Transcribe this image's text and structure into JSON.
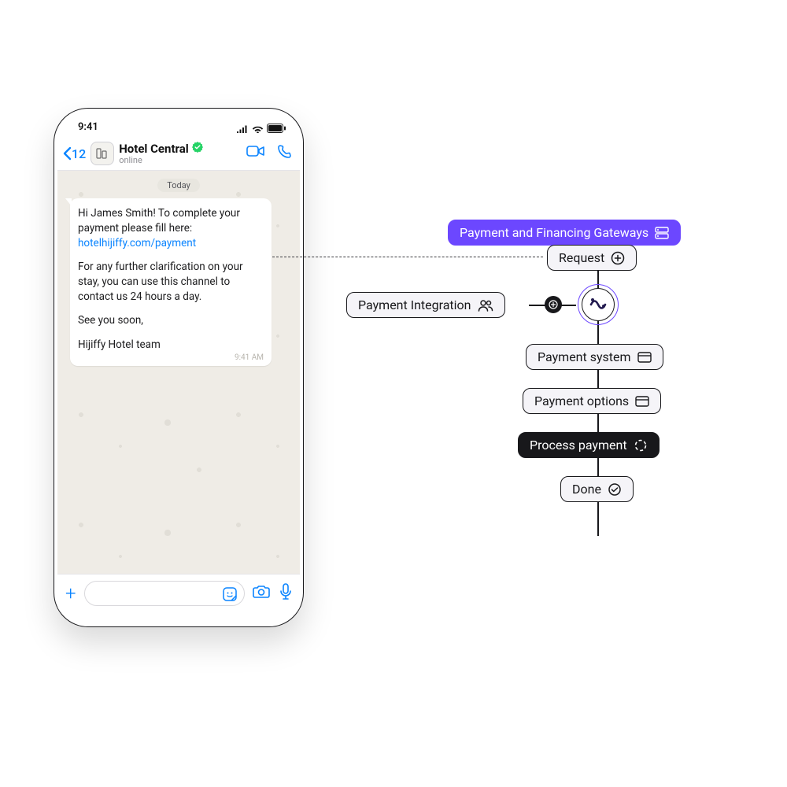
{
  "phone": {
    "status_time": "9:41",
    "back_count": "12",
    "contact": {
      "name": "Hotel Central",
      "status": "online"
    },
    "day_label": "Today",
    "message": {
      "greeting": "Hi James Smith! To complete your payment please fill here:",
      "link": "hotelhijiffy.com/payment",
      "body": "For any further clarification on your stay, you can use this channel to contact us 24 hours a day.",
      "closing": "See you soon,",
      "signature": "Hijiffy Hotel team",
      "time": "9:41 AM"
    }
  },
  "flow": {
    "header": "Payment and Financing Gateways",
    "request": "Request",
    "integration": "Payment Integration",
    "system": "Payment system",
    "options": "Payment options",
    "process": "Process payment",
    "done": "Done"
  }
}
